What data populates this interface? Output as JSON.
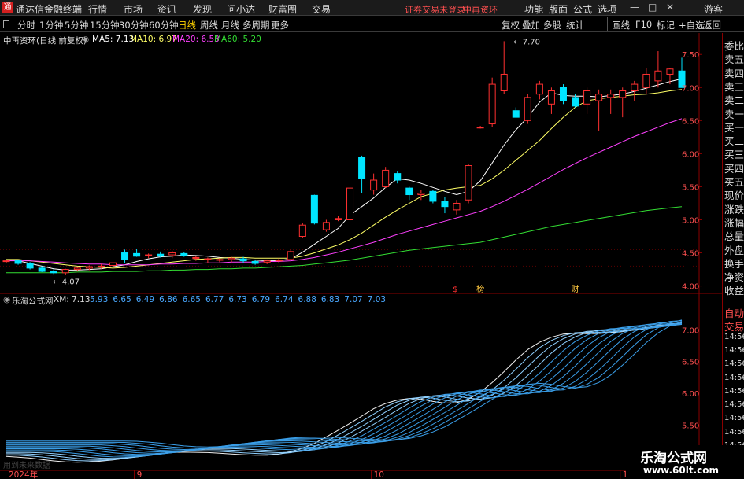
{
  "app": {
    "title": "通达信金融终端",
    "logo_char": "通"
  },
  "menu": {
    "items": [
      "行情",
      "市场",
      "资讯",
      "发现",
      "问小达",
      "财富圈",
      "交易"
    ],
    "status": "证券交易未登录",
    "stock_status": "中再资环",
    "right_items": [
      "功能",
      "版面",
      "公式",
      "选项"
    ],
    "user": "游客",
    "win_buttons": [
      "—",
      "□",
      "✕"
    ]
  },
  "periods": {
    "items": [
      "分时",
      "1分钟",
      "5分钟",
      "15分钟",
      "30分钟",
      "60分钟",
      "日线",
      "周线",
      "月线",
      "多周期",
      "更多"
    ],
    "active": "日线",
    "tools": [
      "复权",
      "叠加",
      "多股",
      "统计",
      "画线",
      "F10",
      "标记",
      "+自选",
      "返回"
    ]
  },
  "main_legend": {
    "name": "中再资环(日线 前复权)",
    "ma5": "MA5: 7.13",
    "ma10": "MA10: 6.97",
    "ma20": "MA20: 6.53",
    "ma60": "MA60: 5.20",
    "colors": {
      "ma5": "#ffffff",
      "ma10": "#ffff66",
      "ma20": "#ff40ff",
      "ma60": "#33dd33"
    }
  },
  "sub_legend": {
    "name": "乐淘公式网",
    "label": "XM: 7.13",
    "values": [
      "5.93",
      "6.65",
      "6.49",
      "6.86",
      "6.65",
      "6.77",
      "6.73",
      "6.79",
      "6.74",
      "6.88",
      "6.83",
      "7.07",
      "7.03"
    ]
  },
  "main_axis": [
    "7.50",
    "7.00",
    "6.50",
    "6.00",
    "5.50",
    "5.00",
    "4.50",
    "4.00"
  ],
  "sub_axis": [
    "7.00",
    "6.50",
    "6.00",
    "5.50",
    "5.00"
  ],
  "sub_axis_right": [
    "自动",
    "交易",
    "14:56",
    "14:56",
    "14:56",
    "14:56",
    "14:56",
    "14:56",
    "14:56",
    "14:56",
    "14:56",
    "14:56"
  ],
  "annotations": {
    "high": "7.70",
    "low": "4.07",
    "marks": [
      "$",
      "榜",
      "财"
    ]
  },
  "x_axis": [
    "2024年",
    "9",
    "10",
    "11"
  ],
  "order_panel": [
    "委比",
    "卖五",
    "卖四",
    "卖三",
    "卖二",
    "卖一",
    "买一",
    "买二",
    "买三",
    "买四",
    "买五",
    "现价",
    "涨跌",
    "涨幅",
    "总量",
    "外盘",
    "换手",
    "净资",
    "收益"
  ],
  "watermark": {
    "line1": "乐淘公式网",
    "line2": "www.60lt.com"
  },
  "faded_text": "用到未来数据",
  "chart_data": {
    "type": "candlestick",
    "ylim": [
      3.9,
      7.8
    ],
    "candles": [
      [
        4.37,
        4.4,
        4.35,
        4.38
      ],
      [
        4.38,
        4.4,
        4.32,
        4.34
      ],
      [
        4.34,
        4.36,
        4.25,
        4.27
      ],
      [
        4.27,
        4.3,
        4.21,
        4.22
      ],
      [
        4.22,
        4.26,
        4.18,
        4.2
      ],
      [
        4.2,
        4.26,
        4.17,
        4.25
      ],
      [
        4.25,
        4.29,
        4.22,
        4.27
      ],
      [
        4.27,
        4.31,
        4.24,
        4.29
      ],
      [
        4.29,
        4.33,
        4.26,
        4.3
      ],
      [
        4.31,
        4.37,
        4.29,
        4.35
      ],
      [
        4.5,
        4.55,
        4.35,
        4.4
      ],
      [
        4.49,
        4.56,
        4.44,
        4.45
      ],
      [
        4.46,
        4.49,
        4.42,
        4.47
      ],
      [
        4.48,
        4.52,
        4.43,
        4.45
      ],
      [
        4.47,
        4.53,
        4.42,
        4.5
      ],
      [
        4.49,
        4.51,
        4.44,
        4.46
      ],
      [
        4.42,
        4.45,
        4.38,
        4.43
      ],
      [
        4.4,
        4.43,
        4.34,
        4.41
      ],
      [
        4.39,
        4.42,
        4.36,
        4.4
      ],
      [
        4.4,
        4.44,
        4.36,
        4.42
      ],
      [
        4.41,
        4.44,
        4.35,
        4.38
      ],
      [
        4.37,
        4.4,
        4.32,
        4.34
      ],
      [
        4.36,
        4.4,
        4.33,
        4.38
      ],
      [
        4.38,
        4.42,
        4.35,
        4.39
      ],
      [
        4.4,
        4.55,
        4.39,
        4.52
      ],
      [
        4.75,
        4.95,
        4.73,
        4.92
      ],
      [
        5.37,
        5.38,
        4.93,
        4.95
      ],
      [
        4.85,
        5.0,
        4.82,
        4.96
      ],
      [
        5.0,
        5.06,
        4.98,
        5.02
      ],
      [
        5.0,
        5.5,
        4.98,
        5.48
      ],
      [
        5.95,
        5.97,
        5.4,
        5.62
      ],
      [
        5.45,
        5.7,
        5.38,
        5.6
      ],
      [
        5.5,
        5.8,
        5.48,
        5.75
      ],
      [
        5.7,
        5.73,
        5.55,
        5.6
      ],
      [
        5.48,
        5.5,
        5.3,
        5.38
      ],
      [
        5.38,
        5.45,
        5.3,
        5.4
      ],
      [
        5.43,
        5.45,
        5.25,
        5.28
      ],
      [
        5.28,
        5.35,
        5.1,
        5.2
      ],
      [
        5.15,
        5.3,
        5.08,
        5.25
      ],
      [
        5.3,
        5.85,
        5.25,
        5.82
      ],
      [
        6.4,
        6.42,
        6.38,
        6.4
      ],
      [
        6.45,
        7.15,
        6.4,
        7.05
      ],
      [
        6.95,
        7.7,
        6.9,
        7.2
      ],
      [
        6.65,
        6.7,
        6.55,
        6.55
      ],
      [
        6.5,
        6.9,
        6.45,
        6.85
      ],
      [
        6.9,
        7.1,
        6.82,
        7.05
      ],
      [
        6.75,
        7.0,
        6.6,
        6.95
      ],
      [
        7.0,
        7.05,
        6.75,
        6.8
      ],
      [
        6.85,
        6.9,
        6.7,
        6.72
      ],
      [
        6.75,
        7.0,
        6.6,
        6.95
      ],
      [
        6.8,
        6.97,
        6.35,
        6.9
      ],
      [
        6.85,
        6.97,
        6.6,
        6.9
      ],
      [
        6.85,
        7.0,
        6.55,
        6.95
      ],
      [
        6.95,
        7.1,
        6.8,
        7.05
      ],
      [
        7.0,
        7.3,
        6.9,
        7.2
      ],
      [
        7.1,
        7.55,
        7.0,
        7.25
      ],
      [
        7.2,
        7.3,
        7.05,
        7.28
      ],
      [
        7.25,
        7.45,
        7.15,
        7.0
      ]
    ],
    "series": [
      {
        "name": "MA5",
        "values": [
          4.39,
          4.38,
          4.34,
          4.3,
          4.26,
          4.24,
          4.24,
          4.25,
          4.26,
          4.29,
          4.32,
          4.37,
          4.41,
          4.44,
          4.45,
          4.47,
          4.46,
          4.45,
          4.43,
          4.42,
          4.4,
          4.39,
          4.38,
          4.38,
          4.41,
          4.51,
          4.63,
          4.75,
          4.87,
          5.07,
          5.2,
          5.33,
          5.49,
          5.62,
          5.6,
          5.55,
          5.49,
          5.43,
          5.38,
          5.43,
          5.59,
          5.86,
          6.13,
          6.36,
          6.55,
          6.78,
          6.92,
          6.88,
          6.87,
          6.87,
          6.86,
          6.88,
          6.9,
          6.94,
          6.99,
          7.04,
          7.09,
          7.13
        ]
      },
      {
        "name": "MA10",
        "values": [
          4.4,
          4.4,
          4.38,
          4.36,
          4.34,
          4.32,
          4.3,
          4.29,
          4.28,
          4.27,
          4.28,
          4.3,
          4.32,
          4.34,
          4.36,
          4.38,
          4.4,
          4.41,
          4.42,
          4.43,
          4.43,
          4.42,
          4.42,
          4.42,
          4.42,
          4.45,
          4.5,
          4.56,
          4.62,
          4.7,
          4.8,
          4.92,
          5.04,
          5.15,
          5.25,
          5.35,
          5.4,
          5.45,
          5.48,
          5.5,
          5.52,
          5.62,
          5.75,
          5.9,
          6.05,
          6.2,
          6.38,
          6.55,
          6.7,
          6.8,
          6.83,
          6.85,
          6.87,
          6.89,
          6.9,
          6.92,
          6.95,
          6.97
        ]
      },
      {
        "name": "MA20",
        "values": [
          4.38,
          4.38,
          4.38,
          4.37,
          4.36,
          4.35,
          4.34,
          4.33,
          4.33,
          4.32,
          4.32,
          4.32,
          4.32,
          4.33,
          4.33,
          4.34,
          4.34,
          4.35,
          4.35,
          4.36,
          4.36,
          4.36,
          4.37,
          4.37,
          4.38,
          4.4,
          4.43,
          4.47,
          4.51,
          4.56,
          4.61,
          4.66,
          4.72,
          4.78,
          4.83,
          4.88,
          4.93,
          4.98,
          5.03,
          5.08,
          5.13,
          5.2,
          5.28,
          5.37,
          5.46,
          5.56,
          5.66,
          5.76,
          5.85,
          5.94,
          6.02,
          6.1,
          6.18,
          6.26,
          6.33,
          6.4,
          6.47,
          6.53
        ]
      },
      {
        "name": "MA60",
        "values": [
          4.2,
          4.2,
          4.2,
          4.2,
          4.2,
          4.2,
          4.21,
          4.21,
          4.21,
          4.22,
          4.22,
          4.22,
          4.23,
          4.23,
          4.24,
          4.24,
          4.25,
          4.25,
          4.26,
          4.26,
          4.27,
          4.27,
          4.28,
          4.29,
          4.3,
          4.31,
          4.33,
          4.35,
          4.37,
          4.39,
          4.42,
          4.45,
          4.48,
          4.51,
          4.54,
          4.56,
          4.58,
          4.6,
          4.62,
          4.64,
          4.66,
          4.7,
          4.74,
          4.78,
          4.82,
          4.86,
          4.9,
          4.93,
          4.96,
          4.99,
          5.02,
          5.05,
          5.08,
          5.11,
          5.14,
          5.16,
          5.18,
          5.2
        ]
      }
    ],
    "sub": {
      "ylim": [
        4.8,
        7.4
      ],
      "current": 7.13
    }
  }
}
